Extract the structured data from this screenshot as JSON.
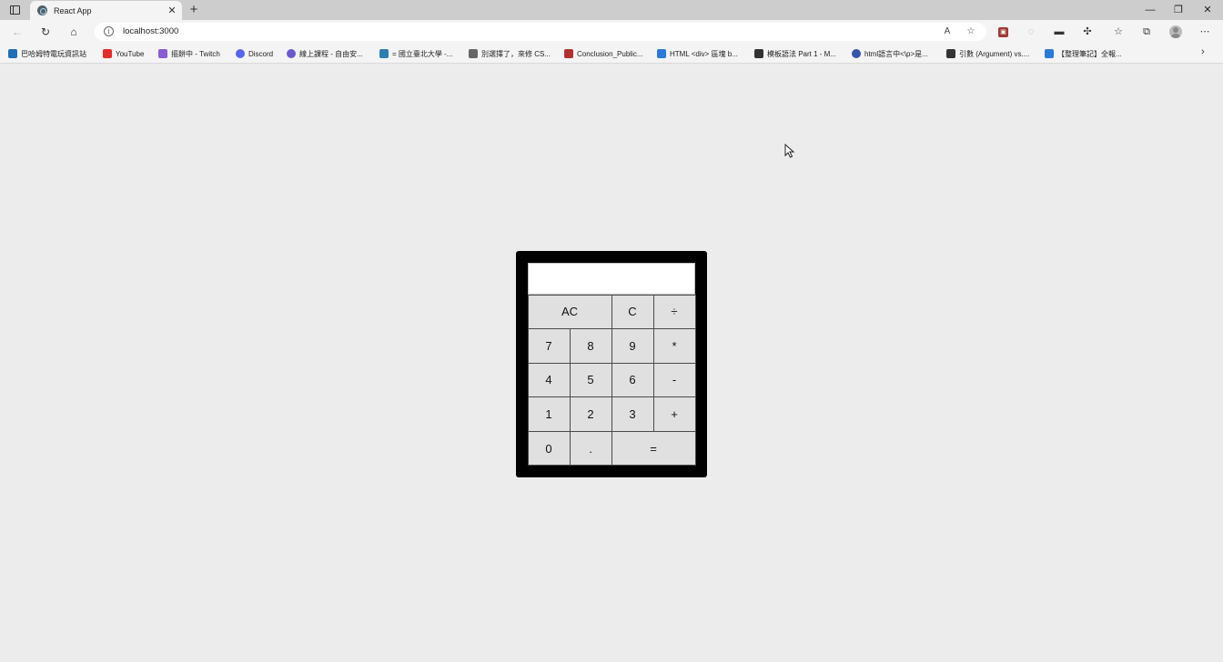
{
  "browser": {
    "tab": {
      "title": "React App"
    },
    "address": {
      "url": "localhost:3000"
    },
    "bookmarks": [
      {
        "label": "巴哈姆特電玩資訊站",
        "icon_color": "#1e6fb8"
      },
      {
        "label": "YouTube",
        "icon_color": "#e52d27"
      },
      {
        "label": "摳餅中 - Twitch",
        "icon_color": "#8a5bd1"
      },
      {
        "label": "Discord",
        "icon_color": "#5865f2"
      },
      {
        "label": "線上課程 - 自由安...",
        "icon_color": "#6a5acd"
      },
      {
        "label": "= 國立臺北大學 -...",
        "icon_color": "#2d7fb0"
      },
      {
        "label": "別選擇了，來修 CS...",
        "icon_color": "#666666"
      },
      {
        "label": "Conclusion_Public...",
        "icon_color": "#b03030"
      },
      {
        "label": "HTML <div> 區塊 b...",
        "icon_color": "#2a7bd8"
      },
      {
        "label": "模板語法 Part 1 - M...",
        "icon_color": "#333333"
      },
      {
        "label": "html語言中<\\p>是...",
        "icon_color": "#3355aa"
      },
      {
        "label": "引數 (Argument) vs....",
        "icon_color": "#333333"
      },
      {
        "label": "【整理筆記】全報...",
        "icon_color": "#2a7bd8"
      }
    ]
  },
  "calculator": {
    "display_value": "",
    "keys": [
      {
        "label": "AC",
        "name": "ac-key",
        "wide": true
      },
      {
        "label": "C",
        "name": "c-key",
        "wide": false
      },
      {
        "label": "÷",
        "name": "divide-key",
        "wide": false
      },
      {
        "label": "7",
        "name": "digit-7-key",
        "wide": false
      },
      {
        "label": "8",
        "name": "digit-8-key",
        "wide": false
      },
      {
        "label": "9",
        "name": "digit-9-key",
        "wide": false
      },
      {
        "label": "*",
        "name": "multiply-key",
        "wide": false
      },
      {
        "label": "4",
        "name": "digit-4-key",
        "wide": false
      },
      {
        "label": "5",
        "name": "digit-5-key",
        "wide": false
      },
      {
        "label": "6",
        "name": "digit-6-key",
        "wide": false
      },
      {
        "label": "-",
        "name": "subtract-key",
        "wide": false
      },
      {
        "label": "1",
        "name": "digit-1-key",
        "wide": false
      },
      {
        "label": "2",
        "name": "digit-2-key",
        "wide": false
      },
      {
        "label": "3",
        "name": "digit-3-key",
        "wide": false
      },
      {
        "label": "+",
        "name": "add-key",
        "wide": false
      },
      {
        "label": "0",
        "name": "digit-0-key",
        "wide": false
      },
      {
        "label": ".",
        "name": "decimal-key",
        "wide": false
      },
      {
        "label": "=",
        "name": "equals-key",
        "wide": true
      }
    ]
  }
}
